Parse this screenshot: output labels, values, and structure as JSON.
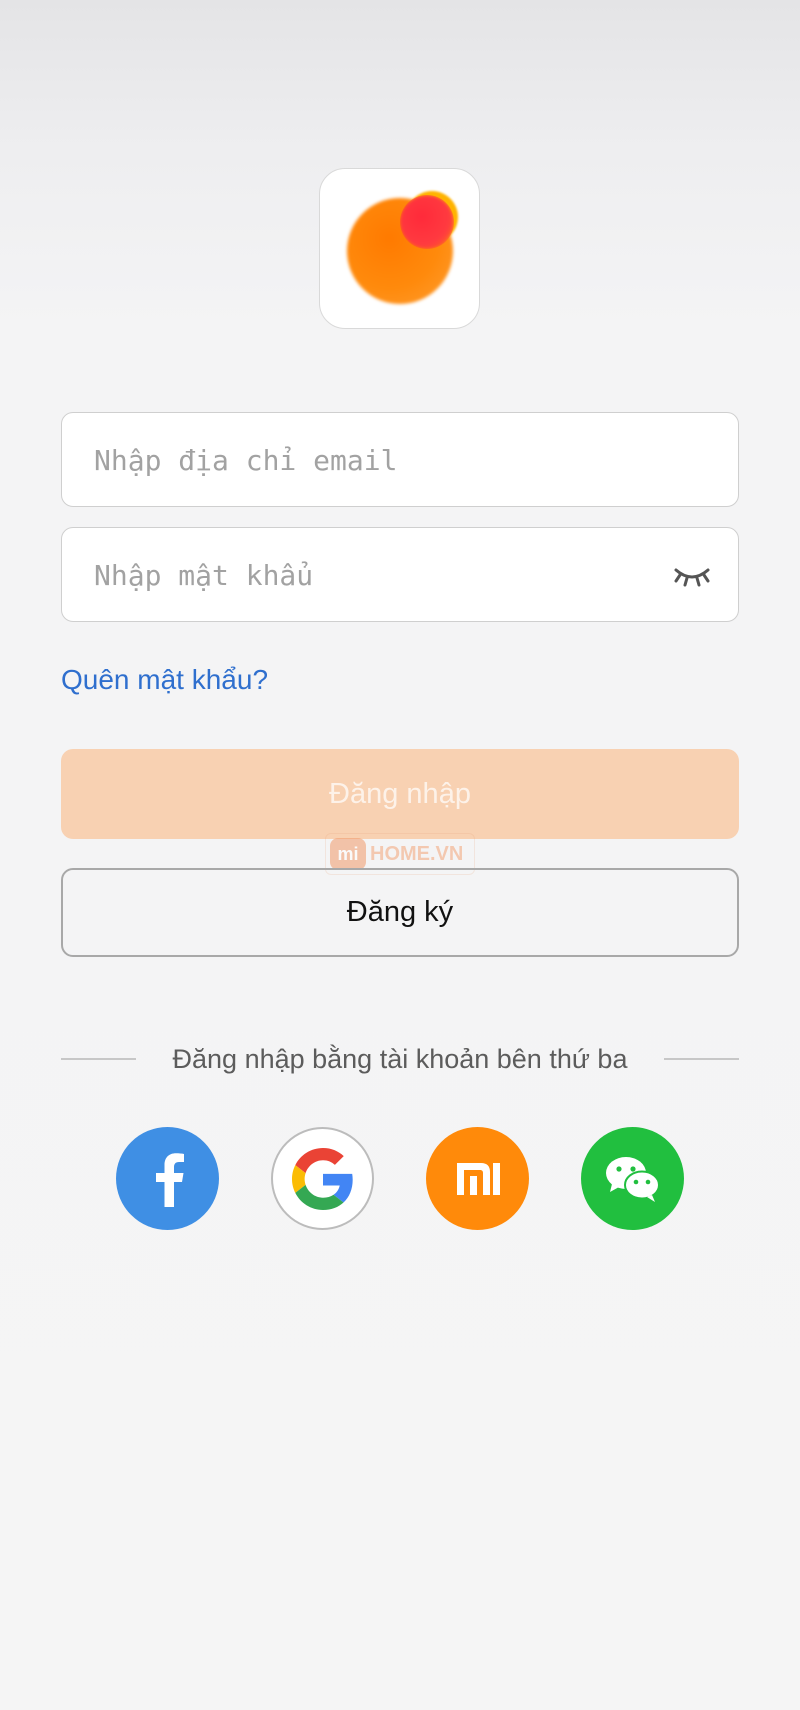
{
  "email_field": {
    "placeholder": "Nhập địa chỉ email",
    "value": ""
  },
  "password_field": {
    "placeholder": "Nhập mật khẩu",
    "value": ""
  },
  "forgot_password_label": "Quên mật khẩu?",
  "login_button_label": "Đăng nhập",
  "register_button_label": "Đăng ký",
  "third_party_label": "Đăng nhập bằng tài khoản bên thứ ba",
  "watermark": {
    "badge": "mi",
    "text": "HOME.VN"
  },
  "social_logins": [
    {
      "icon": "facebook-icon",
      "color": "#3f8fe4"
    },
    {
      "icon": "google-icon",
      "color": "#ffffff"
    },
    {
      "icon": "mi-icon",
      "color": "#ff8a0a"
    },
    {
      "icon": "wechat-icon",
      "color": "#21bf3f"
    }
  ],
  "colors": {
    "accent_orange": "#ff8a0a",
    "login_button_disabled": "#f8d1b2",
    "link_blue": "#2f6fce"
  }
}
